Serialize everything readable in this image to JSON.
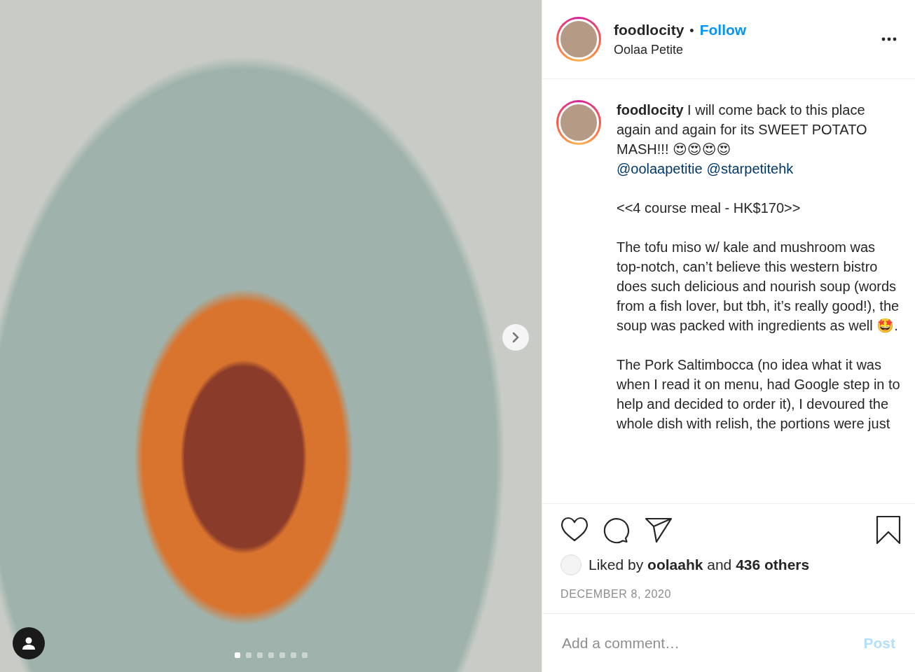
{
  "post": {
    "photo": {
      "dots": [
        {
          "selected": true
        },
        {
          "selected": false
        },
        {
          "selected": false
        },
        {
          "selected": false
        },
        {
          "selected": false
        },
        {
          "selected": false
        },
        {
          "selected": false
        }
      ]
    },
    "header": {
      "username": "foodlocity",
      "separator": "•",
      "follow": "Follow",
      "location": "Oolaa Petite"
    },
    "caption": {
      "username": "foodlocity",
      "text": "I will come back to this place again and again for its SWEET POTATO MASH!!! 😍😍😍😍",
      "mentions": [
        "@oolaapetitie",
        "@starpetitehk"
      ],
      "paragraphs": [
        "<<4 course meal - HK$170>>",
        "The tofu miso w/ kale and mushroom was top-notch, can’t believe this western bistro does such delicious and nourish soup (words from a fish lover, but tbh, it’s really good!), the soup was packed with ingredients as well 🤩.",
        "The Pork Saltimbocca (no idea what it was when I read it on menu, had Google step in to help and decided to order it), I devoured the whole dish with relish, the portions were just"
      ]
    },
    "likes": {
      "text": "Liked by **oolaahk** and **436 others**"
    },
    "date": "DECEMBER 8, 2020",
    "comment": {
      "placeholder": "Add a comment…",
      "button": "Post"
    }
  }
}
